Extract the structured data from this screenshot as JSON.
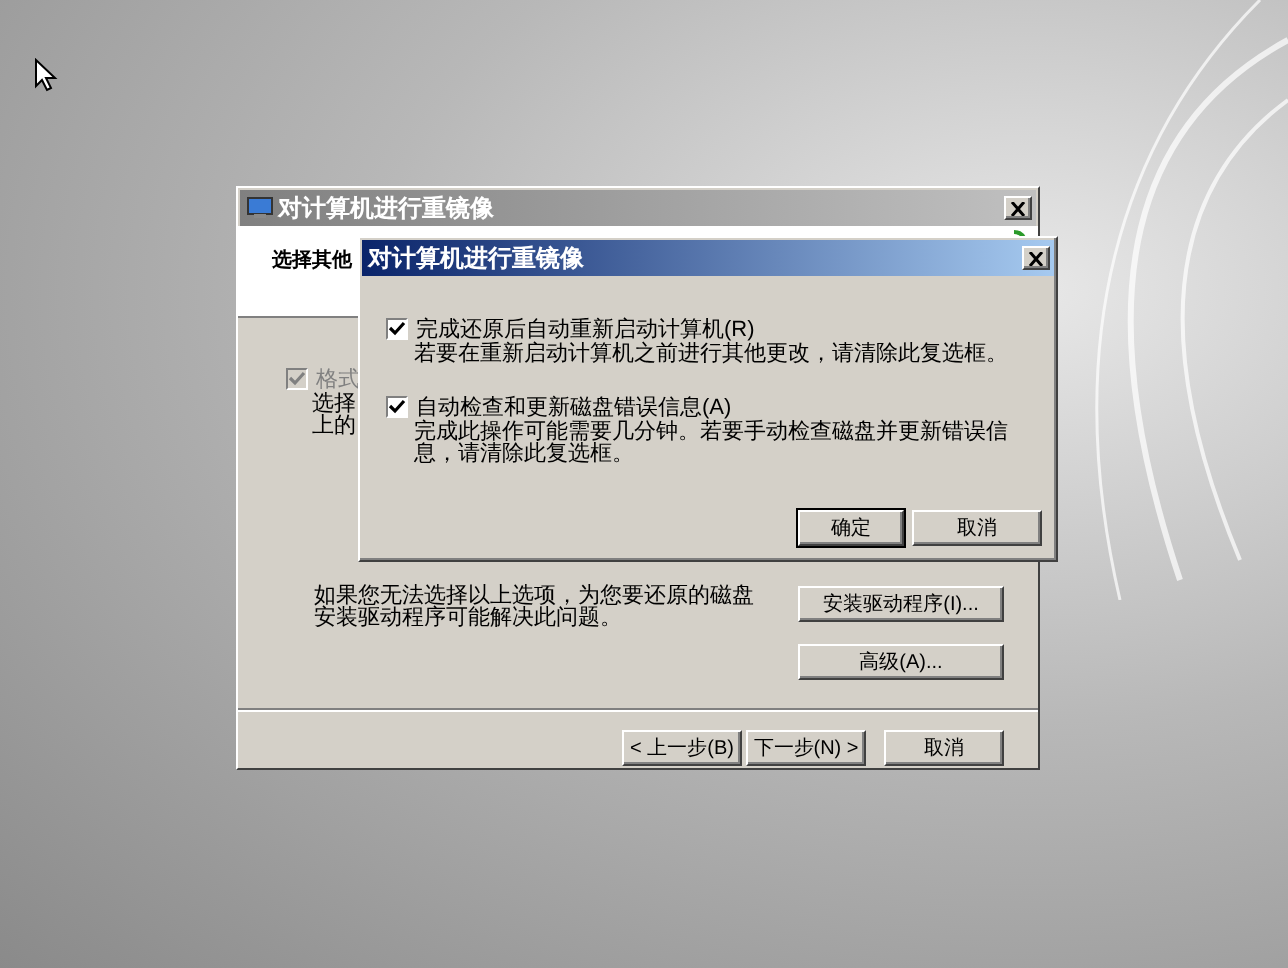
{
  "back_dialog": {
    "title": "对计算机进行重镜像",
    "heading": "选择其他",
    "format_option": {
      "label": "格式",
      "checked": true,
      "disabled": true
    },
    "option_lines": [
      "选择",
      "上的"
    ],
    "driver_text": "如果您无法选择以上选项，为您要还原的磁盘安装驱动程序可能解决此问题。",
    "driver_button": "安装驱动程序(I)...",
    "advanced_button": "高级(A)...",
    "nav_buttons": [
      "< 上一步(B)",
      "下一步(N) >",
      "取消"
    ]
  },
  "front_dialog": {
    "title": "对计算机进行重镜像",
    "options": [
      {
        "label": "完成还原后自动重新启动计算机(R)",
        "checked": true,
        "description": "若要在重新启动计算机之前进行其他更改，请清除此复选框。"
      },
      {
        "label": "自动检查和更新磁盘错误信息(A)",
        "checked": true,
        "description": "完成此操作可能需要几分钟。若要手动检查磁盘并更新错误信息，请清除此复选框。"
      }
    ],
    "buttons": [
      {
        "label": "确定",
        "default": true
      },
      {
        "label": "取消",
        "default": false
      }
    ]
  }
}
